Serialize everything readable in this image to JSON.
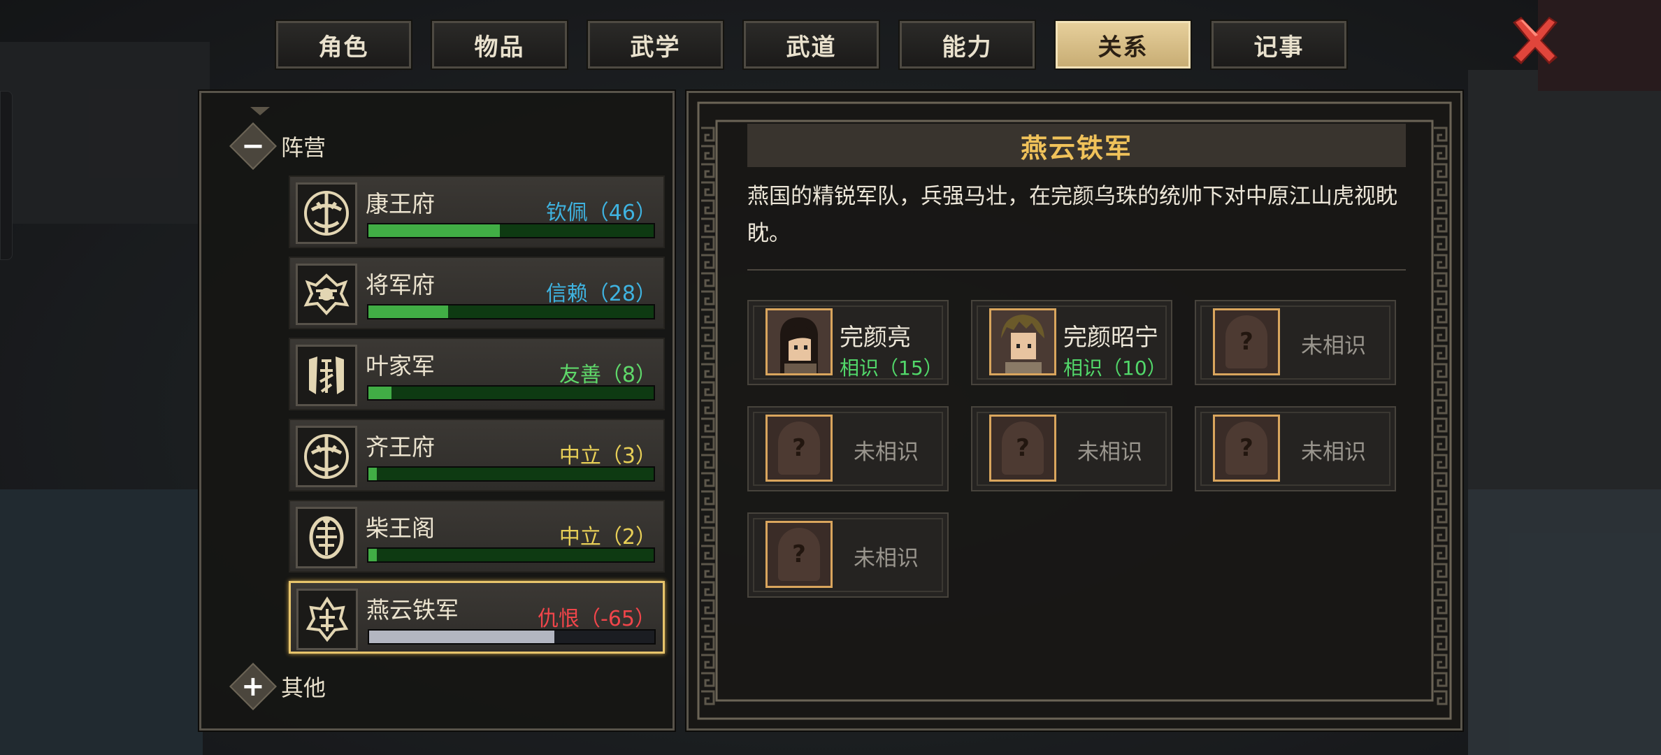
{
  "tabs": [
    {
      "label": "角色",
      "active": false
    },
    {
      "label": "物品",
      "active": false
    },
    {
      "label": "武学",
      "active": false
    },
    {
      "label": "武道",
      "active": false
    },
    {
      "label": "能力",
      "active": false
    },
    {
      "label": "关系",
      "active": true
    },
    {
      "label": "记事",
      "active": false
    }
  ],
  "close_icon": "close-x-icon",
  "groups": {
    "camp": {
      "label": "阵营",
      "toggle": "−"
    },
    "other": {
      "label": "其他",
      "toggle": "+"
    }
  },
  "factions": [
    {
      "name": "康王府",
      "relation": "钦佩（46）",
      "level": 0.46,
      "color": "#3fb3e0"
    },
    {
      "name": "将军府",
      "relation": "信赖（28）",
      "level": 0.28,
      "color": "#3fb3e0"
    },
    {
      "name": "叶家军",
      "relation": "友善（8）",
      "level": 0.08,
      "color": "#5fd86a"
    },
    {
      "name": "齐王府",
      "relation": "中立（3）",
      "level": 0.03,
      "color": "#e8cf57"
    },
    {
      "name": "柴王阁",
      "relation": "中立（2）",
      "level": 0.02,
      "color": "#e8cf57"
    },
    {
      "name": "燕云铁军",
      "relation": "仇恨（-65）",
      "level": 0.65,
      "color": "#f0454a",
      "selected": true
    }
  ],
  "detail": {
    "title": "燕云铁军",
    "description": "燕国的精锐军队，兵强马壮，在完颜乌珠的统帅下对中原江山虎视眈眈。",
    "members": [
      {
        "name": "完颜亮",
        "relation": "相识（15）",
        "known": true
      },
      {
        "name": "完颜昭宁",
        "relation": "相识（10）",
        "known": true
      },
      {
        "unknown_label": "未相识",
        "known": false
      },
      {
        "unknown_label": "未相识",
        "known": false
      },
      {
        "unknown_label": "未相识",
        "known": false
      },
      {
        "unknown_label": "未相识",
        "known": false
      },
      {
        "unknown_label": "未相识",
        "known": false
      }
    ],
    "unknown_mark": "?"
  }
}
